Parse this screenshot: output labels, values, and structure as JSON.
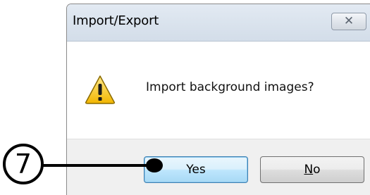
{
  "dialog": {
    "title": "Import/Export",
    "close_icon": "close-icon",
    "message": "Import background images?",
    "icon": "warning-icon",
    "buttons": {
      "yes_label": "Yes",
      "no_label": "N",
      "no_label_rest": "o"
    }
  },
  "annotation": {
    "step_number": "7"
  }
}
